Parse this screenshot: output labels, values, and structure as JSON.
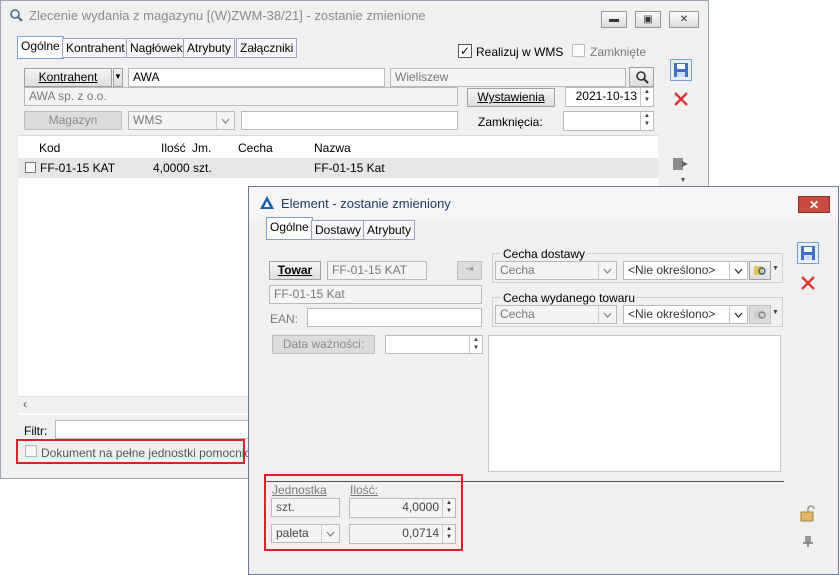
{
  "main": {
    "title": "Zlecenie wydania z magazynu [(W)ZWM-38/21]  - zostanie zmienione",
    "tabs": [
      "Ogólne",
      "Kontrahent",
      "Nagłówek",
      "Atrybuty",
      "Załączniki"
    ],
    "realizuj_label": "Realizuj w WMS",
    "realizuj_checked": true,
    "zamkniete_label": "Zamknięte",
    "kontrahent_button": "Kontrahent",
    "kontrahent_code": "AWA",
    "kontrahent_city": "Wieliszew",
    "kontrahent_name": "AWA sp. z o.o.",
    "wystawienia_button": "Wystawienia",
    "wystawienia_date": "2021-10-13",
    "magazyn_button": "Magazyn",
    "magazyn_value": "WMS",
    "zamkniecia_label": "Zamknięcia:",
    "table": {
      "columns": [
        "Kod",
        "Ilość",
        "Jm.",
        "Cecha",
        "Nazwa"
      ],
      "rows": [
        {
          "kod": "FF-01-15 KAT",
          "ilosc": "4,0000",
          "jm": "szt.",
          "cecha": "",
          "nazwa": "FF-01-15 Kat"
        }
      ]
    },
    "filter_label": "Filtr:",
    "pelne_jednostki_label": "Dokument na pełne jednostki pomocnicze"
  },
  "dialog": {
    "title": "Element - zostanie zmieniony",
    "tabs": [
      "Ogólne",
      "Dostawy",
      "Atrybuty"
    ],
    "towar_button": "Towar",
    "towar_code": "FF-01-15 KAT",
    "towar_name": "FF-01-15 Kat",
    "ean_label": "EAN:",
    "ean_value": "",
    "data_waznosci_button": "Data ważności:",
    "cecha_dostawy_label": "Cecha dostawy",
    "cecha_wydanego_label": "Cecha wydanego towaru",
    "cecha_combo": "Cecha",
    "nieokreslono": "<Nie określono>",
    "jednostka_label": "Jednostka",
    "ilosc_label": "Ilość:",
    "unit1": "szt.",
    "qty1": "4,0000",
    "unit2": "paleta",
    "qty2": "0,0714"
  },
  "colors": {
    "highlight_border": "#d9232a",
    "title_blue": "#1c3a5e",
    "close_red": "#c74b40"
  }
}
